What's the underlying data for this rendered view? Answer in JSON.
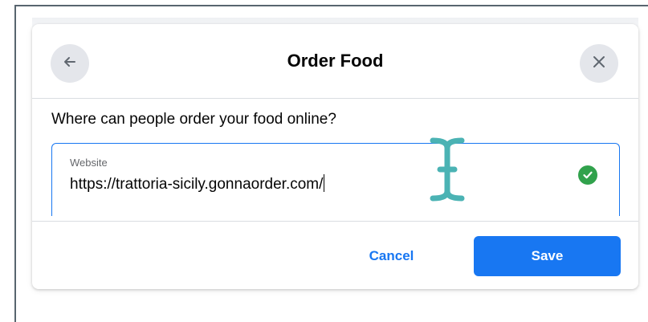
{
  "dialog": {
    "title": "Order Food",
    "back_icon": "arrow-left-icon",
    "close_icon": "close-icon",
    "question": "Where can people order your food online?",
    "website_field": {
      "label": "Website",
      "value": "https://trattoria-sicily.gonnaorder.com/",
      "status_icon": "check-circle-icon"
    },
    "cancel_label": "Cancel",
    "save_label": "Save"
  },
  "colors": {
    "accent": "#1877f2",
    "success": "#31a24c",
    "cursor": "#4bb3b4",
    "icon_button_bg": "#e4e6eb",
    "frame": "#58656f"
  }
}
